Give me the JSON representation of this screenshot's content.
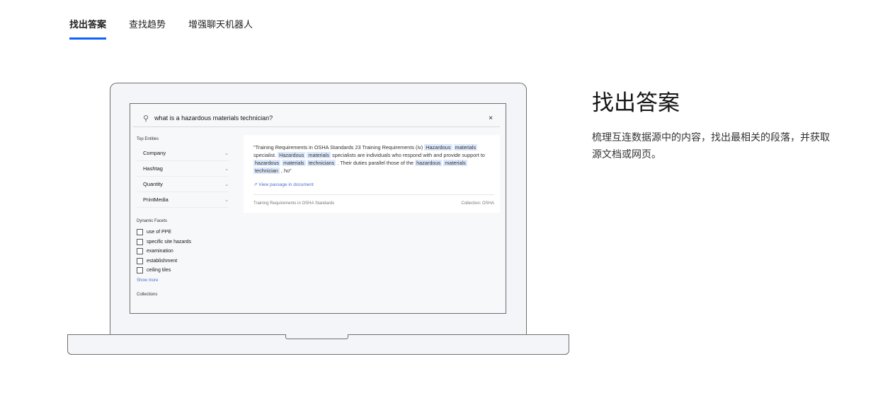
{
  "tabs": [
    {
      "label": "找出答案",
      "active": true
    },
    {
      "label": "查找趋势"
    },
    {
      "label": "增强聊天机器人"
    }
  ],
  "accent": "#0f62fe",
  "app": {
    "search": {
      "value": "what is a hazardous materials technician?",
      "icon": "search-icon",
      "clear": "×"
    },
    "top_entities": {
      "title": "Top Entities",
      "items": [
        "Company",
        "Hashtag",
        "Quantity",
        "PrintMedia"
      ]
    },
    "dynamic_facets": {
      "title": "Dynamic Facets",
      "items": [
        "use of PPE",
        "specific site hazards",
        "examination",
        "establishment",
        "ceiling tiles"
      ],
      "show_more": "Show more"
    },
    "collections_title": "Collections",
    "result": {
      "segments": [
        {
          "t": "\"Training Requirements in OSHA Standards 23 Training Requirements (iv) "
        },
        {
          "t": "Hazardous",
          "hl": true
        },
        {
          "t": " "
        },
        {
          "t": "materials",
          "hl": true
        },
        {
          "t": " specialist. "
        },
        {
          "t": "Hazardous",
          "hl": true
        },
        {
          "t": " "
        },
        {
          "t": "materials",
          "hl": true
        },
        {
          "t": " specialists are individuals who respond with and provide support to "
        },
        {
          "t": "hazardous",
          "hl": true
        },
        {
          "t": " "
        },
        {
          "t": "materials",
          "hl": true
        },
        {
          "t": " "
        },
        {
          "t": "technicians",
          "hl": true
        },
        {
          "t": " . Their duties parallel those of the "
        },
        {
          "t": "hazardous",
          "hl": true
        },
        {
          "t": " "
        },
        {
          "t": "materials",
          "hl": true
        },
        {
          "t": " "
        },
        {
          "t": "technician",
          "hl": true
        },
        {
          "t": " , ho\""
        }
      ],
      "view_passage": "View passage in document",
      "document": "Training Requirements in OSHA Standards",
      "collection": "Collection: OSHA"
    }
  },
  "feature": {
    "title": "找出答案",
    "description": "梳理互连数据源中的内容，找出最相关的段落，并获取源文档或网页。"
  }
}
